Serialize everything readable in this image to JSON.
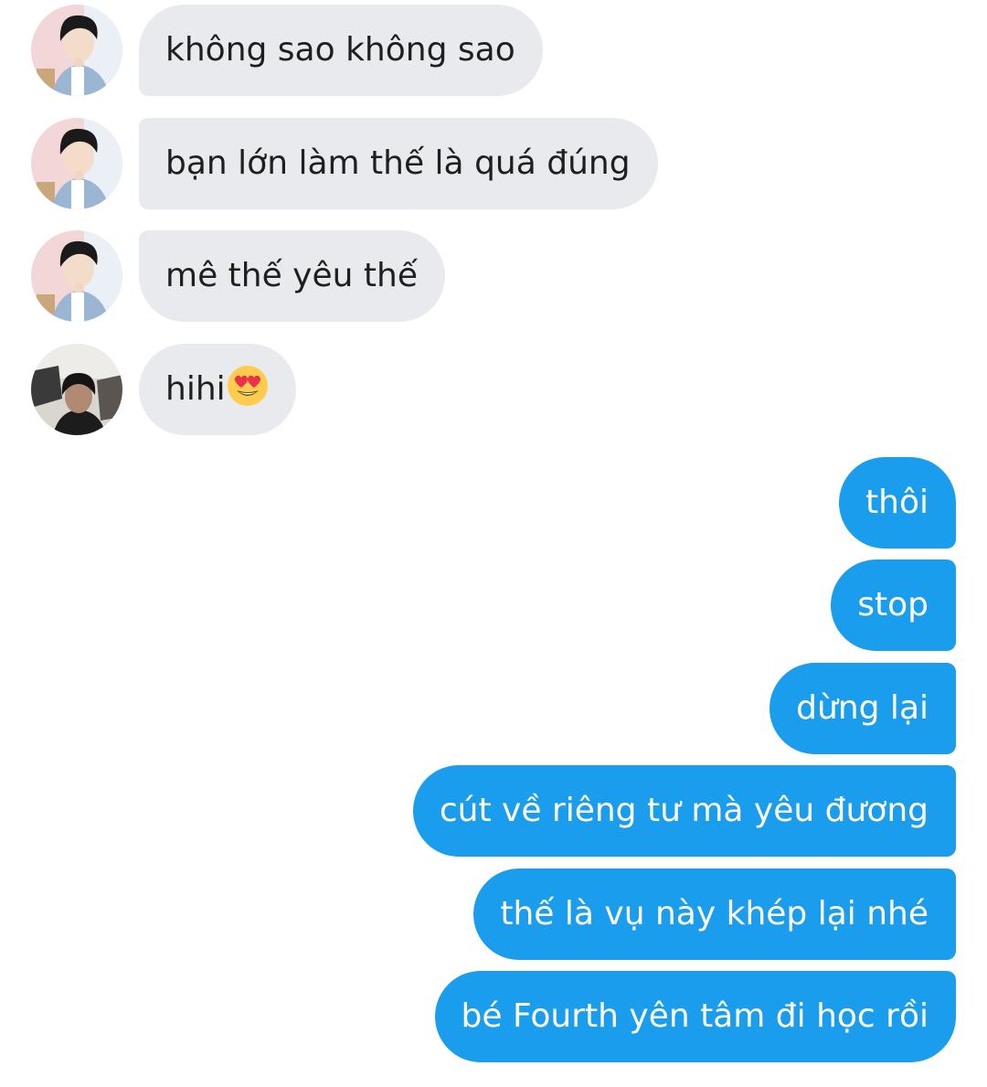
{
  "messages": {
    "incoming": [
      {
        "avatar": "avatar-boy-pink-background",
        "text": "không sao không sao"
      },
      {
        "avatar": "avatar-boy-pink-background",
        "text": "bạn lớn làm thế là quá đúng"
      },
      {
        "avatar": "avatar-boy-pink-background",
        "text": "mê thế yêu thế"
      },
      {
        "avatar": "avatar-dark-selfie",
        "text": "hihi",
        "emoji": "heart-eyes-emoji"
      }
    ],
    "outgoing": [
      {
        "text": "thôi"
      },
      {
        "text": "stop"
      },
      {
        "text": "dừng lại"
      },
      {
        "text": "cút về riêng tư mà yêu đương"
      },
      {
        "text": "thế là vụ này khép lại nhé"
      },
      {
        "text": "bé Fourth yên tâm đi học rồi"
      }
    ]
  },
  "colors": {
    "incoming_bubble": "#e8eaed",
    "outgoing_bubble": "#1b9ded",
    "incoming_text": "#1f1f1f",
    "outgoing_text": "#ffffff"
  }
}
